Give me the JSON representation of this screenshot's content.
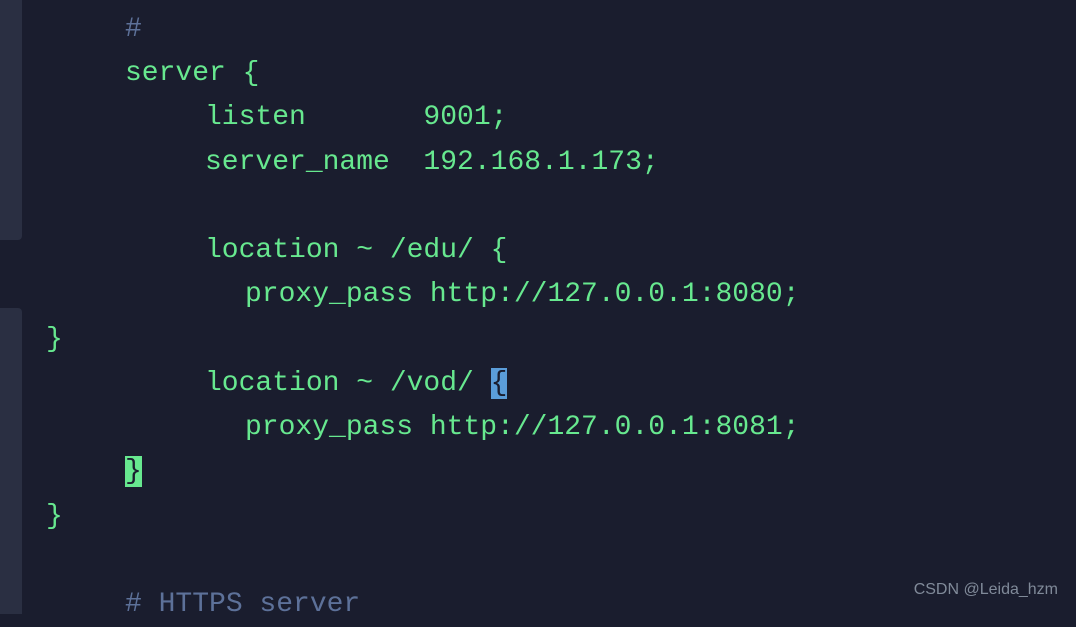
{
  "code": {
    "lines": [
      {
        "indent": 1,
        "segments": [
          {
            "cls": "comment",
            "text": "#"
          }
        ]
      },
      {
        "indent": 1,
        "segments": [
          {
            "cls": "keyword",
            "text": "server {"
          }
        ]
      },
      {
        "indent": 2,
        "segments": [
          {
            "cls": "keyword",
            "text": "listen       9001;"
          }
        ]
      },
      {
        "indent": 2,
        "segments": [
          {
            "cls": "keyword",
            "text": "server_name  192.168.1.173;"
          }
        ]
      },
      {
        "indent": 2,
        "segments": [
          {
            "cls": "keyword",
            "text": ""
          }
        ]
      },
      {
        "indent": 2,
        "segments": [
          {
            "cls": "keyword",
            "text": "location ~ /edu/ {"
          }
        ]
      },
      {
        "indent": 3,
        "segments": [
          {
            "cls": "keyword",
            "text": "proxy_pass http://127.0.0.1:8080;"
          }
        ]
      },
      {
        "indent": 0,
        "segments": [
          {
            "cls": "keyword",
            "text": "}"
          }
        ]
      },
      {
        "indent": 2,
        "segments": [
          {
            "cls": "keyword",
            "text": "location ~ /vod/ "
          },
          {
            "cls": "cursor-highlight",
            "text": "{"
          }
        ]
      },
      {
        "indent": 3,
        "segments": [
          {
            "cls": "keyword",
            "text": "proxy_pass http://127.0.0.1:8081;"
          }
        ]
      },
      {
        "indent": 1,
        "segments": [
          {
            "cls": "brace-match",
            "text": "}"
          }
        ]
      },
      {
        "indent": 0,
        "segments": [
          {
            "cls": "keyword",
            "text": "}"
          }
        ]
      },
      {
        "indent": 0,
        "segments": [
          {
            "cls": "keyword",
            "text": ""
          }
        ]
      },
      {
        "indent": 1,
        "segments": [
          {
            "cls": "comment",
            "text": "# HTTPS server"
          }
        ]
      }
    ]
  },
  "watermark": "CSDN @Leida_hzm"
}
